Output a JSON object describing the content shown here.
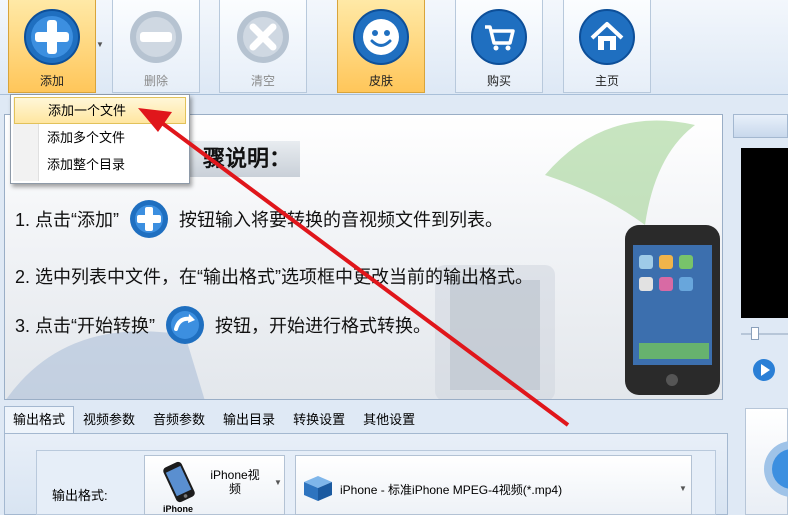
{
  "toolbar": {
    "add_label": "添加",
    "delete_label": "删除",
    "clear_label": "清空",
    "skin_label": "皮肤",
    "buy_label": "购买",
    "home_label": "主页",
    "add_icon": "plus-circle-icon",
    "delete_icon": "minus-circle-icon",
    "clear_icon": "x-circle-icon",
    "skin_icon": "smiley-icon",
    "buy_icon": "cart-icon",
    "home_icon": "home-icon"
  },
  "add_menu": {
    "items": [
      "添加一个文件",
      "添加多个文件",
      "添加整个目录"
    ],
    "highlighted_index": 0
  },
  "instructions": {
    "title": "骤说明：",
    "step1_prefix": "1. 点击“添加”",
    "step1_suffix": "按钮输入将要转换的音视频文件到列表。",
    "step2": "2. 选中列表中文件，在“输出格式”选项框中更改当前的输出格式。",
    "step3_prefix": "3. 点击“开始转换”",
    "step3_suffix": "按钮，开始进行格式转换。"
  },
  "tabs": [
    "输出格式",
    "视频参数",
    "音频参数",
    "输出目录",
    "转换设置",
    "其他设置"
  ],
  "active_tab_index": 0,
  "output": {
    "label": "输出格式:",
    "device_name": "iPhone视频",
    "device_caption": "iPhone",
    "preset": "iPhone - 标准iPhone MPEG-4视频(*.mp4)"
  },
  "colors": {
    "accent_blue": "#1f6fc0",
    "active_button": "#ffc65a",
    "annotation_red": "#e0161b"
  }
}
